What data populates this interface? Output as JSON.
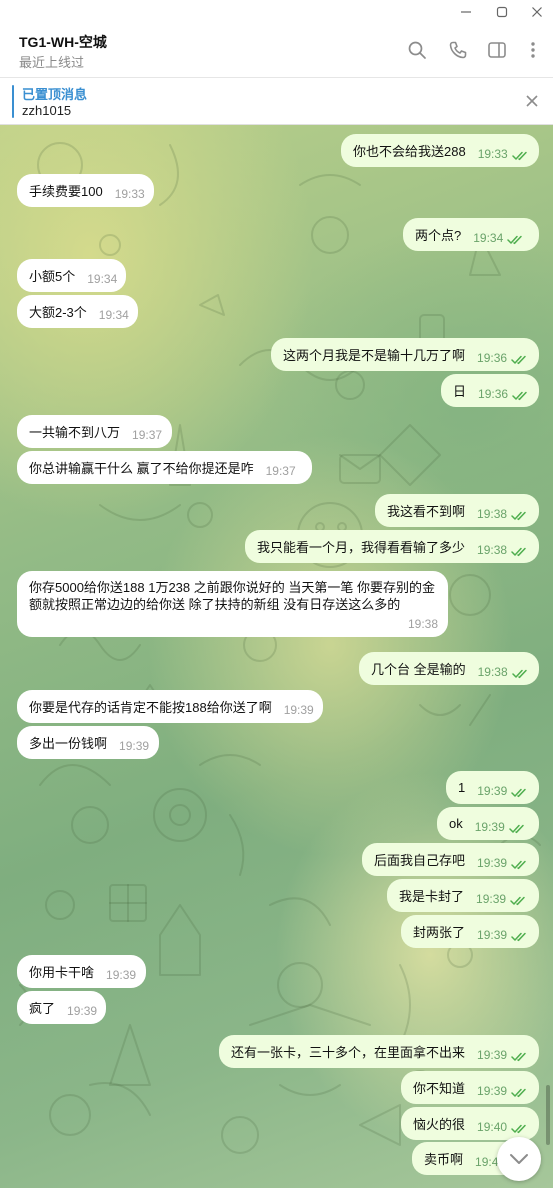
{
  "window": {
    "minimize_icon": "minimize-icon",
    "maximize_icon": "maximize-icon",
    "close_icon": "close-icon"
  },
  "header": {
    "title": "TG1-WH-空城",
    "subtitle": "最近上线过",
    "icons": [
      "search-icon",
      "phone-icon",
      "sidebar-icon",
      "more-icon"
    ]
  },
  "pinned": {
    "title": "已置顶消息",
    "text": "zzh1015"
  },
  "colors": {
    "accent": "#3a8fd1",
    "incoming_bubble": "#ffffff",
    "outgoing_bubble": "#effdde",
    "read_ticks": "#4fae4e"
  },
  "messages": [
    {
      "dir": "out",
      "text": "你也不会给我送288",
      "time": "19:33"
    },
    {
      "dir": "in",
      "text": "手续费要100",
      "time": "19:33"
    },
    {
      "dir": "out",
      "text": "两个点?",
      "time": "19:34"
    },
    {
      "dir": "in",
      "text": "小额5个",
      "time": "19:34"
    },
    {
      "dir": "in",
      "text": "大额2-3个",
      "time": "19:34"
    },
    {
      "dir": "out",
      "text": "这两个月我是不是输十几万了啊",
      "time": "19:36"
    },
    {
      "dir": "out",
      "text": "日",
      "time": "19:36"
    },
    {
      "dir": "in",
      "text": "一共输不到八万",
      "time": "19:37"
    },
    {
      "dir": "in",
      "text": "你总讲输赢干什么  赢了不给你提还是咋",
      "time": "19:37"
    },
    {
      "dir": "out",
      "text": "我这看不到啊",
      "time": "19:38"
    },
    {
      "dir": "out",
      "text": "我只能看一个月，我得看看输了多少",
      "time": "19:38"
    },
    {
      "dir": "in",
      "text": "你存5000给你送188   1万238   之前跟你说好的    当天第一笔    你要存别的金额就按照正常边边的给你送     除了扶持的新组  没有日存送这么多的",
      "time": "19:38"
    },
    {
      "dir": "out",
      "text": "几个台 全是输的",
      "time": "19:38"
    },
    {
      "dir": "in",
      "text": "你要是代存的话肯定不能按188给你送了啊",
      "time": "19:39"
    },
    {
      "dir": "in",
      "text": "多出一份钱啊",
      "time": "19:39"
    },
    {
      "dir": "out",
      "text": "1",
      "time": "19:39"
    },
    {
      "dir": "out",
      "text": "ok",
      "time": "19:39"
    },
    {
      "dir": "out",
      "text": "后面我自己存吧",
      "time": "19:39"
    },
    {
      "dir": "out",
      "text": "我是卡封了",
      "time": "19:39"
    },
    {
      "dir": "out",
      "text": "封两张了",
      "time": "19:39"
    },
    {
      "dir": "in",
      "text": "你用卡干啥",
      "time": "19:39"
    },
    {
      "dir": "in",
      "text": "疯了",
      "time": "19:39"
    },
    {
      "dir": "out",
      "text": "还有一张卡，三十多个，在里面拿不出来",
      "time": "19:39"
    },
    {
      "dir": "out",
      "text": "你不知道",
      "time": "19:39"
    },
    {
      "dir": "out",
      "text": "恼火的很",
      "time": "19:40"
    },
    {
      "dir": "out",
      "text": "卖币啊",
      "time": "19:40"
    }
  ]
}
